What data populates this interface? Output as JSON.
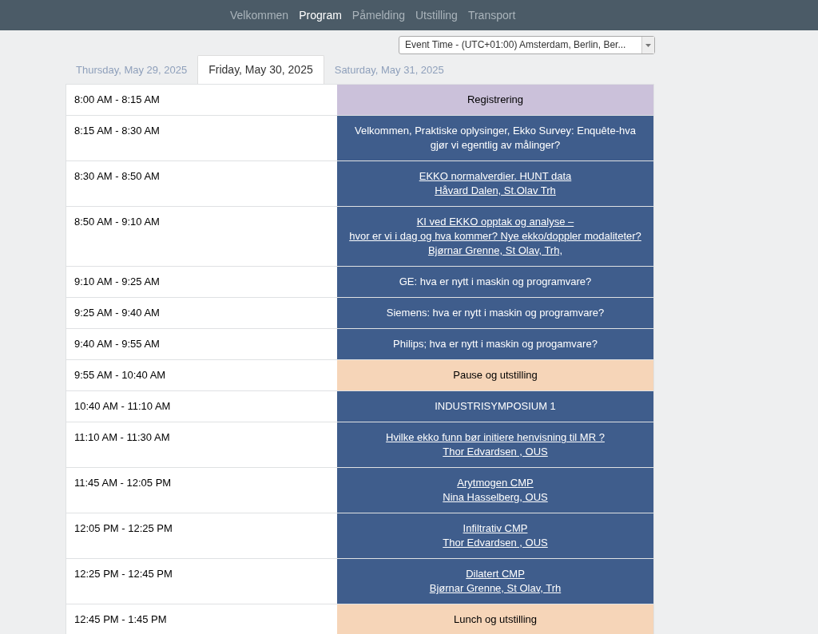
{
  "nav": [
    {
      "label": "Velkommen",
      "selected": false
    },
    {
      "label": "Program",
      "selected": true
    },
    {
      "label": "Påmelding",
      "selected": false
    },
    {
      "label": "Utstilling",
      "selected": false
    },
    {
      "label": "Transport",
      "selected": false
    }
  ],
  "timezone_select": {
    "value": "Event Time - (UTC+01:00) Amsterdam, Berlin, Ber..."
  },
  "day_tabs": [
    {
      "label": "Thursday, May 29, 2025",
      "selected": false
    },
    {
      "label": "Friday, May 30, 2025",
      "selected": true
    },
    {
      "label": "Saturday, May 31, 2025",
      "selected": false
    }
  ],
  "schedule": [
    {
      "time": "8:00 AM - 8:15 AM",
      "kind": "registration",
      "linked": false,
      "lines": [
        "Registrering"
      ]
    },
    {
      "time": "8:15 AM - 8:30 AM",
      "kind": "session",
      "linked": false,
      "lines": [
        "Velkommen, Praktiske oplysinger, Ekko Survey: Enquête-hva gjør vi egentlig av målinger?"
      ]
    },
    {
      "time": "8:30 AM - 8:50 AM",
      "kind": "session",
      "linked": true,
      "lines": [
        "EKKO normalverdier. HUNT data",
        "Håvard Dalen, St.Olav Trh"
      ]
    },
    {
      "time": "8:50 AM - 9:10 AM",
      "kind": "session",
      "linked": true,
      "lines": [
        "KI ved EKKO opptak og analyse –",
        "hvor er vi i dag og hva kommer? Nye ekko/doppler modaliteter?",
        "Bjørnar Grenne, St Olav, Trh,"
      ]
    },
    {
      "time": "9:10 AM - 9:25 AM",
      "kind": "session",
      "linked": false,
      "lines": [
        "GE: hva er nytt i maskin og programvare?"
      ]
    },
    {
      "time": "9:25 AM - 9:40 AM",
      "kind": "session",
      "linked": false,
      "lines": [
        "Siemens: hva er nytt i maskin og programvare?"
      ]
    },
    {
      "time": "9:40 AM - 9:55 AM",
      "kind": "session",
      "linked": false,
      "lines": [
        "Philips; hva er nytt i maskin og progamvare?"
      ]
    },
    {
      "time": "9:55 AM - 10:40 AM",
      "kind": "break",
      "linked": false,
      "lines": [
        "Pause og utstilling"
      ]
    },
    {
      "time": "10:40 AM - 11:10 AM",
      "kind": "session",
      "linked": false,
      "lines": [
        "INDUSTRISYMPOSIUM 1"
      ]
    },
    {
      "time": "11:10 AM - 11:30 AM",
      "kind": "session",
      "linked": true,
      "lines": [
        "Hvilke ekko funn bør initiere henvisning til MR ?",
        "Thor Edvardsen , OUS"
      ]
    },
    {
      "time": "11:45 AM - 12:05 PM",
      "kind": "session",
      "linked": true,
      "lines": [
        "Arytmogen CMP",
        "Nina Hasselberg, OUS"
      ]
    },
    {
      "time": "12:05 PM - 12:25 PM",
      "kind": "session",
      "linked": true,
      "lines": [
        "Infiltrativ CMP",
        "Thor Edvardsen , OUS"
      ]
    },
    {
      "time": "12:25 PM - 12:45 PM",
      "kind": "session",
      "linked": true,
      "lines": [
        "Dilatert CMP",
        "Bjørnar Grenne, St Olav, Trh"
      ]
    },
    {
      "time": "12:45 PM - 1:45 PM",
      "kind": "break",
      "linked": false,
      "lines": [
        "Lunch og utstilling"
      ]
    }
  ]
}
